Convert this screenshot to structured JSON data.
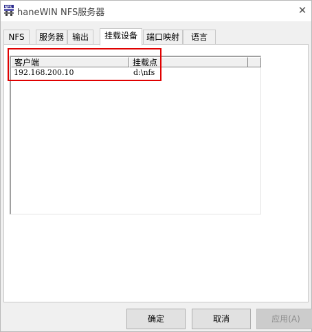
{
  "window": {
    "title": "haneWIN NFS服务器",
    "close_symbol": "✕"
  },
  "tabs": [
    {
      "label": "NFS",
      "active": false
    },
    {
      "label": "服务器",
      "active": false
    },
    {
      "label": "输出",
      "active": false
    },
    {
      "label": "挂载设备",
      "active": true
    },
    {
      "label": "端口映射",
      "active": false
    },
    {
      "label": "语言",
      "active": false
    }
  ],
  "mount_list": {
    "columns": [
      "客户端",
      "挂载点"
    ],
    "rows": [
      {
        "client": "192.168.200.10",
        "mount_point": "d:\\nfs"
      }
    ]
  },
  "buttons": {
    "ok": "确定",
    "cancel": "取消",
    "apply": "应用(A)"
  },
  "colors": {
    "highlight": "#e00000",
    "window_bg": "#f0f0f0"
  }
}
